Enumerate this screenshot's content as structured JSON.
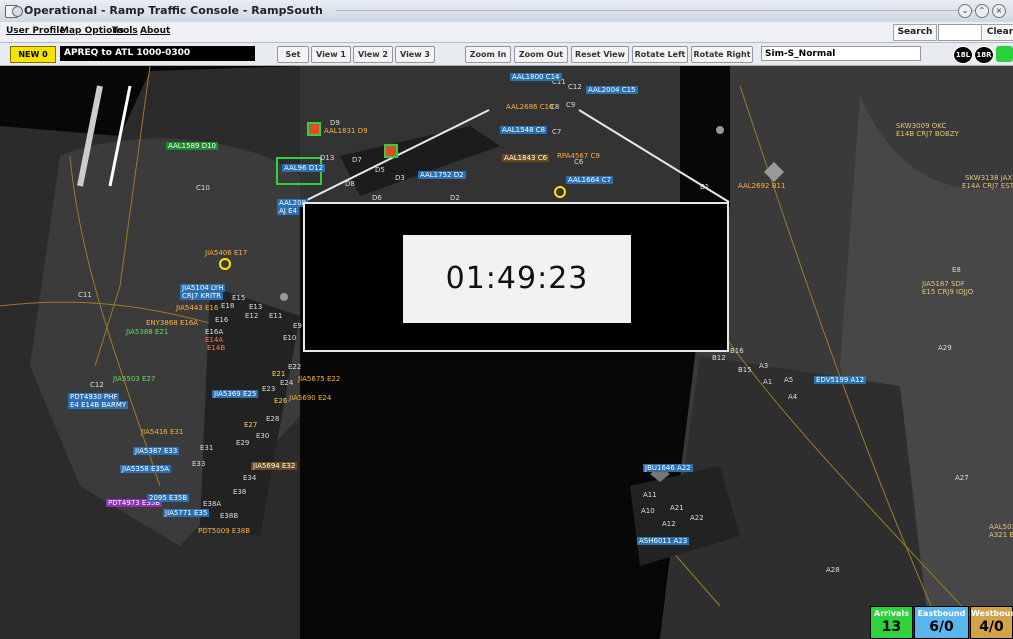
{
  "window": {
    "title": "Operational - Ramp Traffic Console - RampSouth"
  },
  "menu": {
    "items": [
      "User Profile",
      "Map Options",
      "Tools",
      "About"
    ],
    "search_label": "Search",
    "search_value": "",
    "clear_label": "Clear"
  },
  "toolbar": {
    "new_label": "NEW  0",
    "message": "APREQ to ATL 1000-0300",
    "buttons": [
      "Set",
      "View 1",
      "View 2",
      "View 3",
      "Zoom In",
      "Zoom Out",
      "Reset View",
      "Rotate Left",
      "Rotate Right"
    ],
    "config_value": "Sim-S_Normal",
    "status_icons": [
      "18L",
      "18R"
    ]
  },
  "clock": {
    "time": "01:49:23"
  },
  "map": {
    "gate_labels": [
      "C10",
      "C11",
      "C12",
      "D1",
      "D2",
      "D3",
      "D5",
      "D6",
      "D7",
      "D8",
      "D9",
      "D10",
      "D13",
      "E9",
      "E10",
      "E11",
      "E12",
      "E13",
      "E14A",
      "E14B",
      "E15",
      "E16",
      "E16A",
      "E17",
      "E18",
      "E21",
      "E22",
      "E23",
      "E24",
      "E26",
      "E27",
      "E28",
      "E29",
      "E30",
      "E31",
      "E32",
      "E33",
      "E34",
      "E35A",
      "E35C",
      "E36",
      "E38",
      "E38A",
      "E38B",
      "C1",
      "C4",
      "C5",
      "C6",
      "C7",
      "C8",
      "C9",
      "C11",
      "C12",
      "C13",
      "C15",
      "C16",
      "C17",
      "B1",
      "B7",
      "B9",
      "B10",
      "B11",
      "B12",
      "B15",
      "B16",
      "A1",
      "A3",
      "A4",
      "A5",
      "A6",
      "A7",
      "A8",
      "A9",
      "A10",
      "A11",
      "A12",
      "A21",
      "A22",
      "A23",
      "A24",
      "A26",
      "A27",
      "A28",
      "A29",
      "E8",
      "E14",
      "E15",
      "E16"
    ],
    "flights": [
      {
        "id": "AAL1589 D10",
        "style": "grn"
      },
      {
        "id": "AAL1831 D9",
        "style": "ylw"
      },
      {
        "id": "AAL96 D12",
        "style": "arr"
      },
      {
        "id": "AAL208",
        "style": "arr"
      },
      {
        "id": "AJ E4",
        "style": "arr"
      },
      {
        "id": "AAL1752 D2",
        "style": "arr"
      },
      {
        "id": "AAL1800 C14",
        "style": "arr"
      },
      {
        "id": "AAL2004 C15",
        "style": "arr"
      },
      {
        "id": "AAL2686 C10",
        "style": "ylw"
      },
      {
        "id": "AAL1548 C8",
        "style": "arr"
      },
      {
        "id": "AAL1843 C6",
        "style": "dep"
      },
      {
        "id": "RPA4567 C9",
        "style": "ylw"
      },
      {
        "id": "AAL1664 C7",
        "style": "arr"
      },
      {
        "id": "AAL2692 B11",
        "style": "ylw"
      },
      {
        "id": "SKW3009 OKC",
        "style": "dep"
      },
      {
        "id": "E14B CRJ7 BOBZY",
        "style": "dep"
      },
      {
        "id": "SKW3138 JAX",
        "style": "dep"
      },
      {
        "id": "E14A CRJ7 ESTRO",
        "style": "dep"
      },
      {
        "id": "JIA5406 E17",
        "style": "ylw"
      },
      {
        "id": "JIA5104 LYH",
        "style": "arr"
      },
      {
        "id": "CRJ7 KRITR",
        "style": "arr"
      },
      {
        "id": "JIA5443 E16",
        "style": "ylw"
      },
      {
        "id": "ENY3868 E16A",
        "style": "ylw"
      },
      {
        "id": "JIA5388 E21",
        "style": "grn"
      },
      {
        "id": "JIA5187 SDF",
        "style": "dep"
      },
      {
        "id": "E15 CRJ9 IOJJO",
        "style": "dep"
      },
      {
        "id": "JIA5503 E27",
        "style": "grn"
      },
      {
        "id": "PDT4930 PHF",
        "style": "arr"
      },
      {
        "id": "E4 E14B BARMY",
        "style": "arr"
      },
      {
        "id": "JIA5369 E25",
        "style": "arr"
      },
      {
        "id": "JIA5675 E22",
        "style": "ylw"
      },
      {
        "id": "JIA5690 E24",
        "style": "ylw"
      },
      {
        "id": "JIA5416 E31",
        "style": "ylw"
      },
      {
        "id": "JIA5387 E33",
        "style": "arr"
      },
      {
        "id": "JIA5358 E35A",
        "style": "arr"
      },
      {
        "id": "JIA5694 E32",
        "style": "dep"
      },
      {
        "id": "PDT4973 E35B",
        "style": "pur"
      },
      {
        "id": "2095 E35B",
        "style": "arr"
      },
      {
        "id": "JIA5771 E35",
        "style": "arr"
      },
      {
        "id": "PDT5009 E38B",
        "style": "ylw"
      },
      {
        "id": "EDV5199 A12",
        "style": "arr"
      },
      {
        "id": "JBU1646 A22",
        "style": "arr"
      },
      {
        "id": "ASH6011 A23",
        "style": "arr"
      },
      {
        "id": "AAL503",
        "style": "dep"
      },
      {
        "id": "A321 BO",
        "style": "dep"
      }
    ]
  },
  "counters": [
    {
      "label": "Arrivals",
      "value": "13",
      "color": "#2fd13c"
    },
    {
      "label": "Eastbound",
      "value": "6/0",
      "color": "#5ab6ee"
    },
    {
      "label": "Westbound",
      "value": "4/0",
      "color": "#d2a24a"
    }
  ]
}
